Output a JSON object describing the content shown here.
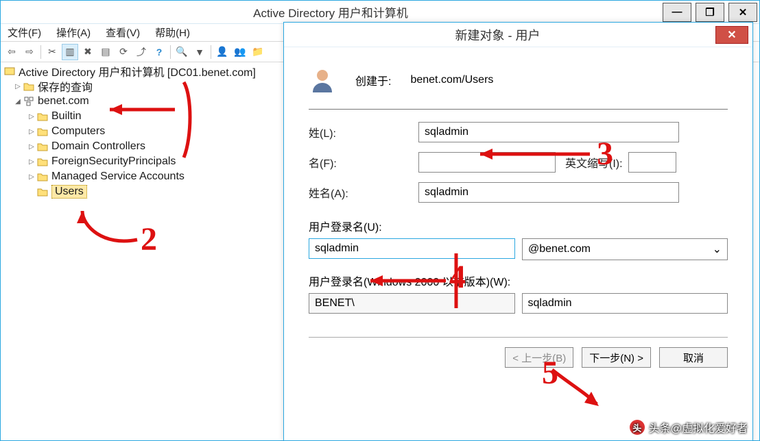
{
  "main": {
    "title": "Active Directory 用户和计算机",
    "menu": {
      "file": "文件(F)",
      "action": "操作(A)",
      "view": "查看(V)",
      "help": "帮助(H)"
    }
  },
  "tree": {
    "root": "Active Directory 用户和计算机 [DC01.benet.com]",
    "saved_queries": "保存的查询",
    "domain": "benet.com",
    "nodes": {
      "builtin": "Builtin",
      "computers": "Computers",
      "dc": "Domain Controllers",
      "fsp": "ForeignSecurityPrincipals",
      "msa": "Managed Service Accounts",
      "users": "Users"
    }
  },
  "dialog": {
    "title": "新建对象 - 用户",
    "created_in_label": "创建于:",
    "created_in_value": "benet.com/Users",
    "last_name_label": "姓(L):",
    "last_name_value": "sqladmin",
    "first_name_label": "名(F):",
    "first_name_value": "",
    "initials_label": "英文缩写(I):",
    "initials_value": "",
    "full_name_label": "姓名(A):",
    "full_name_value": "sqladmin",
    "logon_label": "用户登录名(U):",
    "logon_value": "sqladmin",
    "domain_suffix": "@benet.com",
    "logon_nt_label": "用户登录名(Windows 2000 以前版本)(W):",
    "nt_domain": "BENET\\",
    "nt_user": "sqladmin",
    "btn_back": "< 上一步(B)",
    "btn_next": "下一步(N) >",
    "btn_cancel": "取消"
  },
  "watermark": "头条@虚拟化爱好者"
}
